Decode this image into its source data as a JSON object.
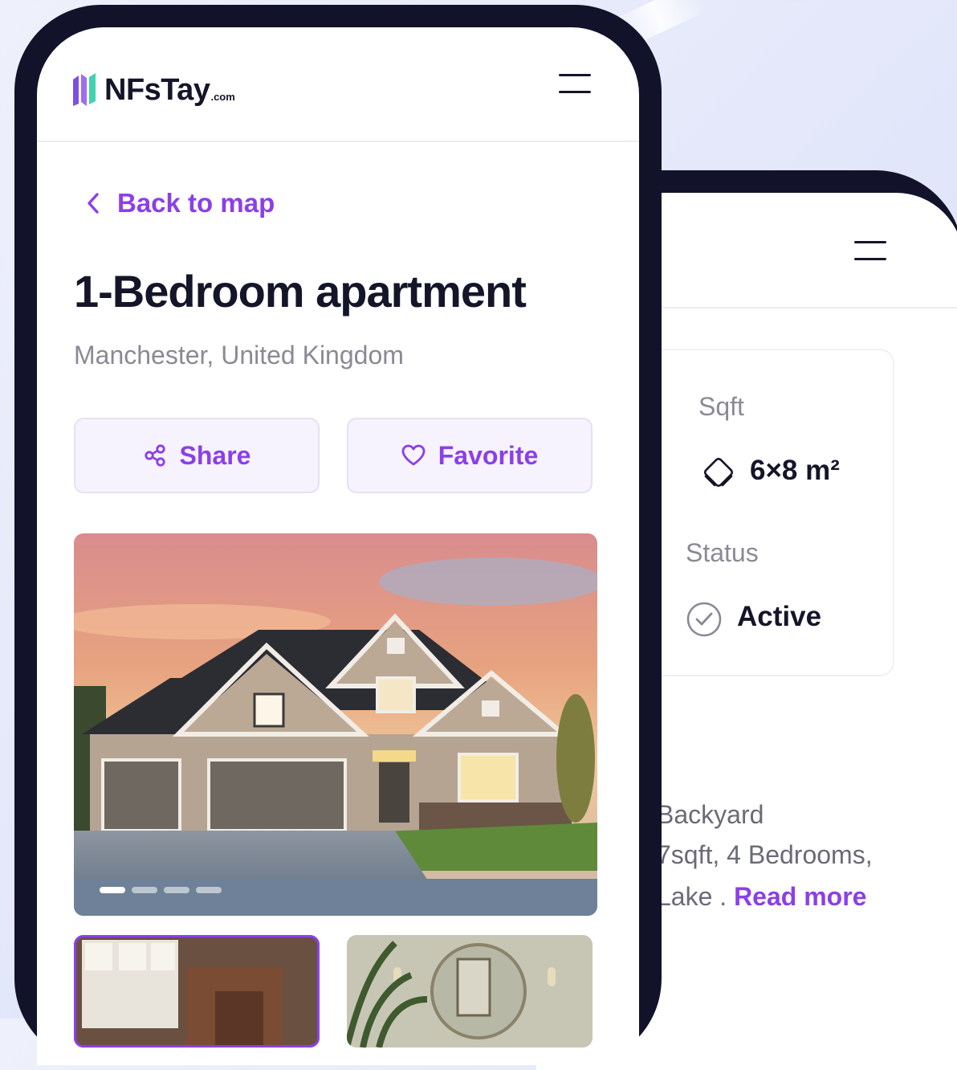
{
  "header": {
    "brand": "NFsTay",
    "brand_tld": ".com"
  },
  "nav": {
    "back_label": "Back to map"
  },
  "listing": {
    "title": "1-Bedroom apartment",
    "location": "Manchester, United Kingdom"
  },
  "actions": {
    "share_label": "Share",
    "favorite_label": "Favorite"
  },
  "gallery": {
    "slide_count": 4,
    "active_slide": 1
  },
  "details": {
    "sqft_label": "Sqft",
    "sqft_value": "6×8 m²",
    "status_label": "Status",
    "status_value": "Active"
  },
  "description": {
    "line1": "Backyard",
    "line2": "7sqft, 4 Bedrooms,",
    "line3": "Lake .",
    "read_more": "Read more"
  },
  "icons": [
    "logo-icon",
    "menu-icon",
    "chevron-left-icon",
    "share-icon",
    "heart-icon",
    "area-icon",
    "check-circle-icon"
  ],
  "colors": {
    "accent": "#8b3fe9",
    "dark": "#15152a",
    "muted": "#8a8a96",
    "button_bg": "#f6f3ff",
    "bezel": "#12122a"
  }
}
